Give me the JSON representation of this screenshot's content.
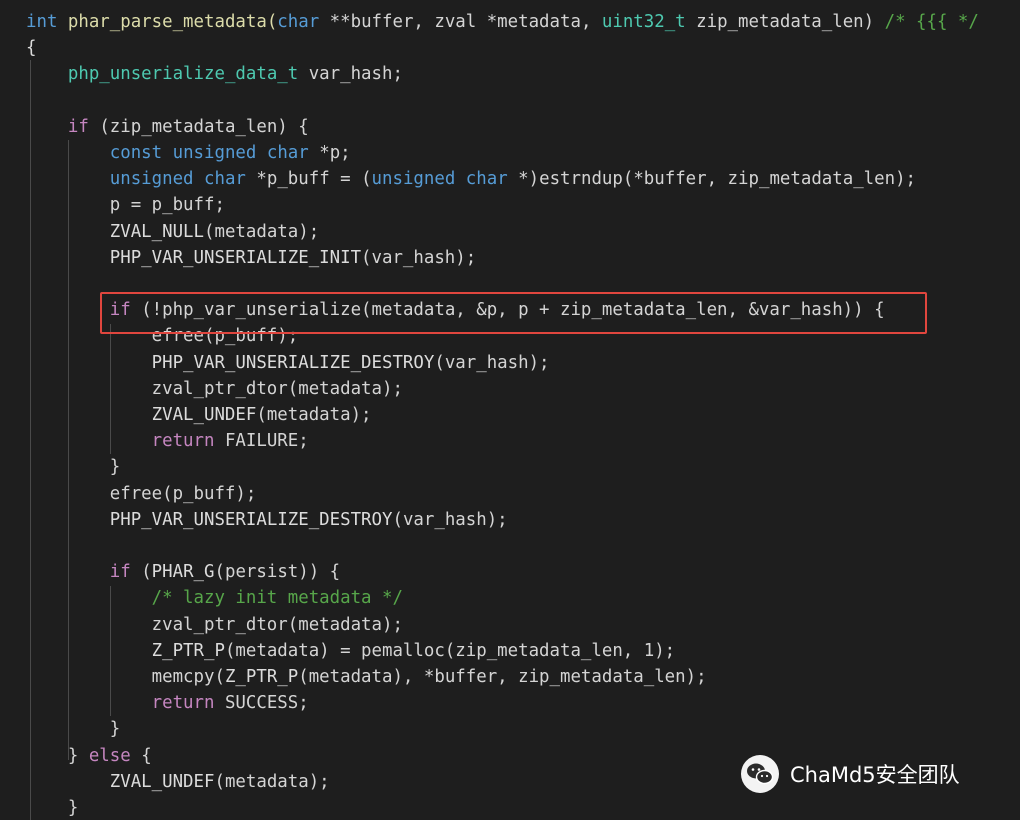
{
  "code": {
    "lines": [
      [
        {
          "t": "int",
          "c": "kw"
        },
        {
          "t": " phar_parse_metadata(",
          "c": "fn"
        },
        {
          "t": "char",
          "c": "kw"
        },
        {
          "t": " **buffer, zval *metadata, ",
          "c": "var"
        },
        {
          "t": "uint32_t",
          "c": "type"
        },
        {
          "t": " zip_metadata_len) ",
          "c": "var"
        },
        {
          "t": "/* {{{ */",
          "c": "com"
        }
      ],
      [
        {
          "t": "{",
          "c": "punc"
        }
      ],
      [
        {
          "t": "    ",
          "c": "var"
        },
        {
          "t": "php_unserialize_data_t",
          "c": "type"
        },
        {
          "t": " var_hash;",
          "c": "var"
        }
      ],
      [
        {
          "t": "",
          "c": "var"
        }
      ],
      [
        {
          "t": "    ",
          "c": "var"
        },
        {
          "t": "if",
          "c": "ctl"
        },
        {
          "t": " (zip_metadata_len) {",
          "c": "var"
        }
      ],
      [
        {
          "t": "        ",
          "c": "var"
        },
        {
          "t": "const",
          "c": "kw"
        },
        {
          "t": " ",
          "c": "var"
        },
        {
          "t": "unsigned",
          "c": "kw"
        },
        {
          "t": " ",
          "c": "var"
        },
        {
          "t": "char",
          "c": "kw"
        },
        {
          "t": " *p;",
          "c": "var"
        }
      ],
      [
        {
          "t": "        ",
          "c": "var"
        },
        {
          "t": "unsigned",
          "c": "kw"
        },
        {
          "t": " ",
          "c": "var"
        },
        {
          "t": "char",
          "c": "kw"
        },
        {
          "t": " *p_buff = (",
          "c": "var"
        },
        {
          "t": "unsigned",
          "c": "kw"
        },
        {
          "t": " ",
          "c": "var"
        },
        {
          "t": "char",
          "c": "kw"
        },
        {
          "t": " *)estrndup(*buffer, zip_metadata_len);",
          "c": "var"
        }
      ],
      [
        {
          "t": "        p = p_buff;",
          "c": "var"
        }
      ],
      [
        {
          "t": "        ",
          "c": "var"
        },
        {
          "t": "ZVAL_NULL",
          "c": "mac"
        },
        {
          "t": "(metadata);",
          "c": "var"
        }
      ],
      [
        {
          "t": "        ",
          "c": "var"
        },
        {
          "t": "PHP_VAR_UNSERIALIZE_INIT",
          "c": "mac"
        },
        {
          "t": "(var_hash);",
          "c": "var"
        }
      ],
      [
        {
          "t": "",
          "c": "var"
        }
      ],
      [
        {
          "t": "        ",
          "c": "var"
        },
        {
          "t": "if",
          "c": "ctl"
        },
        {
          "t": " (!php_var_unserialize(metadata, &p, p + zip_metadata_len, &var_hash)) {",
          "c": "var"
        }
      ],
      [
        {
          "t": "            efree(p_buff);",
          "c": "var"
        }
      ],
      [
        {
          "t": "            ",
          "c": "var"
        },
        {
          "t": "PHP_VAR_UNSERIALIZE_DESTROY",
          "c": "mac"
        },
        {
          "t": "(var_hash);",
          "c": "var"
        }
      ],
      [
        {
          "t": "            zval_ptr_dtor(metadata);",
          "c": "var"
        }
      ],
      [
        {
          "t": "            ",
          "c": "var"
        },
        {
          "t": "ZVAL_UNDEF",
          "c": "mac"
        },
        {
          "t": "(metadata);",
          "c": "var"
        }
      ],
      [
        {
          "t": "            ",
          "c": "var"
        },
        {
          "t": "return",
          "c": "ctl"
        },
        {
          "t": " FAILURE;",
          "c": "var"
        }
      ],
      [
        {
          "t": "        }",
          "c": "var"
        }
      ],
      [
        {
          "t": "        efree(p_buff);",
          "c": "var"
        }
      ],
      [
        {
          "t": "        ",
          "c": "var"
        },
        {
          "t": "PHP_VAR_UNSERIALIZE_DESTROY",
          "c": "mac"
        },
        {
          "t": "(var_hash);",
          "c": "var"
        }
      ],
      [
        {
          "t": "",
          "c": "var"
        }
      ],
      [
        {
          "t": "        ",
          "c": "var"
        },
        {
          "t": "if",
          "c": "ctl"
        },
        {
          "t": " (",
          "c": "var"
        },
        {
          "t": "PHAR_G",
          "c": "mac"
        },
        {
          "t": "(persist)) {",
          "c": "var"
        }
      ],
      [
        {
          "t": "            ",
          "c": "var"
        },
        {
          "t": "/* lazy init metadata */",
          "c": "com"
        }
      ],
      [
        {
          "t": "            zval_ptr_dtor(metadata);",
          "c": "var"
        }
      ],
      [
        {
          "t": "            ",
          "c": "var"
        },
        {
          "t": "Z_PTR_P",
          "c": "mac"
        },
        {
          "t": "(metadata) = pemalloc(zip_metadata_len, 1);",
          "c": "var"
        }
      ],
      [
        {
          "t": "            memcpy(",
          "c": "var"
        },
        {
          "t": "Z_PTR_P",
          "c": "mac"
        },
        {
          "t": "(metadata), *buffer, zip_metadata_len);",
          "c": "var"
        }
      ],
      [
        {
          "t": "            ",
          "c": "var"
        },
        {
          "t": "return",
          "c": "ctl"
        },
        {
          "t": " SUCCESS;",
          "c": "var"
        }
      ],
      [
        {
          "t": "        }",
          "c": "var"
        }
      ],
      [
        {
          "t": "    } ",
          "c": "var"
        },
        {
          "t": "else",
          "c": "ctl"
        },
        {
          "t": " {",
          "c": "var"
        }
      ],
      [
        {
          "t": "        ",
          "c": "var"
        },
        {
          "t": "ZVAL_UNDEF",
          "c": "mac"
        },
        {
          "t": "(metadata);",
          "c": "var"
        }
      ],
      [
        {
          "t": "    }",
          "c": "var"
        }
      ]
    ]
  },
  "watermark": {
    "text": "ChaMd5安全团队",
    "icon": "wechat-icon"
  }
}
